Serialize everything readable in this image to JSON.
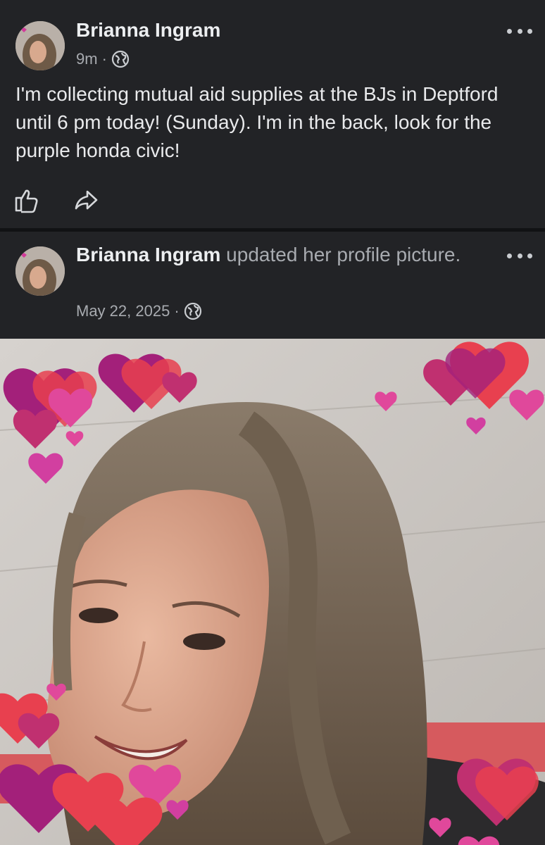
{
  "posts": [
    {
      "author": "Brianna Ingram",
      "time": "9m",
      "separator": "·",
      "privacy_icon": "globe-icon",
      "text": "I'm collecting mutual aid supplies at the BJs in Deptford until 6 pm today! (Sunday). I'm in the back, look for the purple honda civic!",
      "actions": [
        "like-icon",
        "share-icon"
      ]
    },
    {
      "author": "Brianna Ingram",
      "action_text": "updated her profile picture.",
      "time": "May 22, 2025",
      "separator": "·",
      "privacy_icon": "globe-icon",
      "photo_description_icon": "profile-photo"
    }
  ],
  "colors": {
    "background": "#222326",
    "divider": "#111214",
    "text": "#e9eaec",
    "muted": "#a8abb0",
    "heart_pink": "#e0489b",
    "heart_red": "#e8404f",
    "heart_purple": "#a3207a"
  }
}
